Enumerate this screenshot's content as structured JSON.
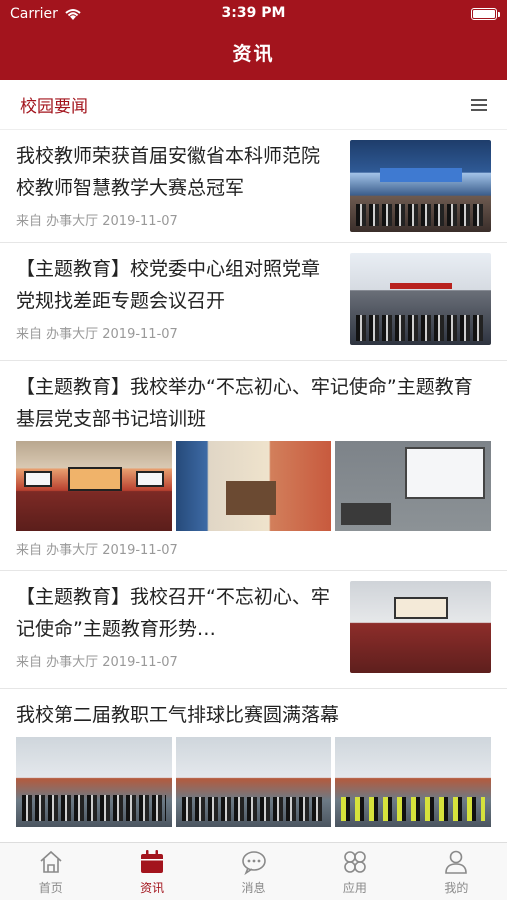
{
  "status_bar": {
    "carrier": "Carrier",
    "time": "3:39 PM"
  },
  "header": {
    "title": "资讯"
  },
  "section": {
    "label": "校园要闻"
  },
  "news": [
    {
      "title": "我校教师荣获首届安徽省本科师范院校教师智慧教学大赛总冠军",
      "meta": "来自 办事大厅 2019-11-07",
      "layout": "thumb"
    },
    {
      "title": "【主题教育】校党委中心组对照党章党规找差距专题会议召开",
      "meta": "来自 办事大厅 2019-11-07",
      "layout": "thumb"
    },
    {
      "title": "【主题教育】我校举办“不忘初心、牢记使命”主题教育基层党支部书记培训班",
      "meta": "来自 办事大厅 2019-11-07",
      "layout": "three"
    },
    {
      "title": "【主题教育】我校召开“不忘初心、牢记使命”主题教育形势…",
      "meta": "来自 办事大厅 2019-11-07",
      "layout": "thumb"
    },
    {
      "title": "我校第二届教职工气排球比赛圆满落幕",
      "meta": "",
      "layout": "three"
    }
  ],
  "tabs": [
    {
      "label": "首页",
      "icon": "home-icon",
      "active": false
    },
    {
      "label": "资讯",
      "icon": "news-icon",
      "active": true
    },
    {
      "label": "消息",
      "icon": "message-icon",
      "active": false
    },
    {
      "label": "应用",
      "icon": "apps-icon",
      "active": false
    },
    {
      "label": "我的",
      "icon": "profile-icon",
      "active": false
    }
  ],
  "colors": {
    "brand": "#a3141d",
    "inactive": "#8a8a8a"
  }
}
